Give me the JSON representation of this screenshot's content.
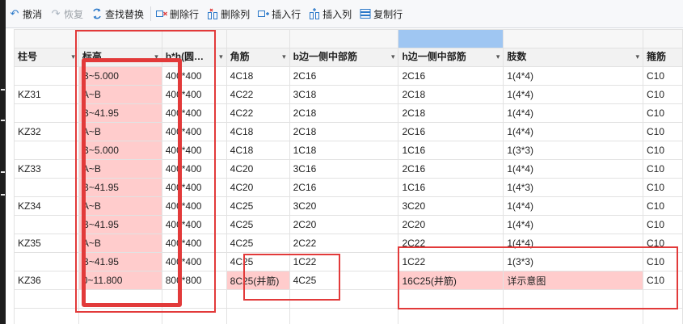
{
  "toolbar": {
    "undo": "撤消",
    "redo": "恢复",
    "find_replace": "查找替换",
    "delete_row": "删除行",
    "delete_col": "删除列",
    "insert_row": "插入行",
    "insert_col": "插入列",
    "copy_row": "复制行"
  },
  "columns": [
    "柱号",
    "标高",
    "b*h(圆…",
    "角筋",
    "b边一侧中部筋",
    "h边一侧中部筋",
    "肢数",
    "箍筋"
  ],
  "rows": [
    {
      "id": "",
      "elev": "B~5.000",
      "bh": "400*400",
      "corner": "4C18",
      "b": "2C16",
      "h": "2C16",
      "legs": "1(4*4)",
      "stir": "C10"
    },
    {
      "id": "KZ31",
      "elev": "A~B",
      "bh": "400*400",
      "corner": "4C22",
      "b": "3C18",
      "h": "2C18",
      "legs": "1(4*4)",
      "stir": "C10"
    },
    {
      "id": "",
      "elev": "B~41.95",
      "bh": "400*400",
      "corner": "4C22",
      "b": "2C18",
      "h": "2C18",
      "legs": "1(4*4)",
      "stir": "C10"
    },
    {
      "id": "KZ32",
      "elev": "A~B",
      "bh": "400*400",
      "corner": "4C18",
      "b": "2C18",
      "h": "2C16",
      "legs": "1(4*4)",
      "stir": "C10"
    },
    {
      "id": "",
      "elev": "B~5.000",
      "bh": "400*400",
      "corner": "4C18",
      "b": "1C18",
      "h": "1C16",
      "legs": "1(3*3)",
      "stir": "C10"
    },
    {
      "id": "KZ33",
      "elev": "A~B",
      "bh": "400*400",
      "corner": "4C20",
      "b": "3C16",
      "h": "2C16",
      "legs": "1(4*4)",
      "stir": "C10"
    },
    {
      "id": "",
      "elev": "B~41.95",
      "bh": "400*400",
      "corner": "4C20",
      "b": "2C16",
      "h": "1C16",
      "legs": "1(4*3)",
      "stir": "C10"
    },
    {
      "id": "KZ34",
      "elev": "A~B",
      "bh": "400*400",
      "corner": "4C25",
      "b": "3C20",
      "h": "3C20",
      "legs": "1(4*4)",
      "stir": "C10"
    },
    {
      "id": "",
      "elev": "B~41.95",
      "bh": "400*400",
      "corner": "4C25",
      "b": "2C20",
      "h": "2C20",
      "legs": "1(4*4)",
      "stir": "C10"
    },
    {
      "id": "KZ35",
      "elev": "A~B",
      "bh": "400*400",
      "corner": "4C25",
      "b": "2C22",
      "h": "2C22",
      "legs": "1(4*4)",
      "stir": "C10"
    },
    {
      "id": "",
      "elev": "B~41.95",
      "bh": "400*400",
      "corner": "4C25",
      "b": "1C22",
      "h": "1C22",
      "legs": "1(3*3)",
      "stir": "C10"
    },
    {
      "id": "KZ36",
      "elev": "0~11.800",
      "bh": "800*800",
      "corner": "8C25(并筋)",
      "b": "4C25",
      "h": "16C25(并筋)",
      "legs": "详示意图",
      "stir": "C10"
    }
  ],
  "colors": {
    "highlight": "#ffcccc",
    "annotation": "#e23a3a",
    "selected_col": "#9fc6f2"
  }
}
